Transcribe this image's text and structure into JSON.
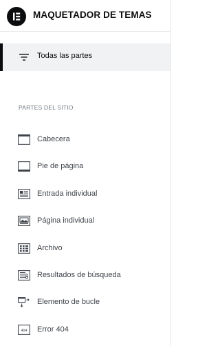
{
  "header": {
    "title": "MAQUETADOR DE TEMAS",
    "logo_icon": "elementor-logo-icon"
  },
  "all_parts": {
    "label": "Todas las partes",
    "icon": "filter-lines-icon",
    "selected": true
  },
  "section": {
    "title": "PARTES DEL SITIO"
  },
  "items": [
    {
      "label": "Cabecera",
      "icon": "header-template-icon"
    },
    {
      "label": "Pie de página",
      "icon": "footer-template-icon"
    },
    {
      "label": "Entrada individual",
      "icon": "single-post-icon"
    },
    {
      "label": "Página individual",
      "icon": "single-page-icon"
    },
    {
      "label": "Archivo",
      "icon": "archive-icon"
    },
    {
      "label": "Resultados de búsqueda",
      "icon": "search-results-icon"
    },
    {
      "label": "Elemento de bucle",
      "icon": "loop-item-icon"
    },
    {
      "label": "Error 404",
      "icon": "error-404-icon",
      "icon_text": "404"
    }
  ],
  "colors": {
    "text_primary": "#0c0d0e",
    "text_secondary": "#3f444b",
    "text_muted": "#6d7882",
    "selected_bg": "#f1f2f3",
    "border": "#e6e8ea"
  }
}
